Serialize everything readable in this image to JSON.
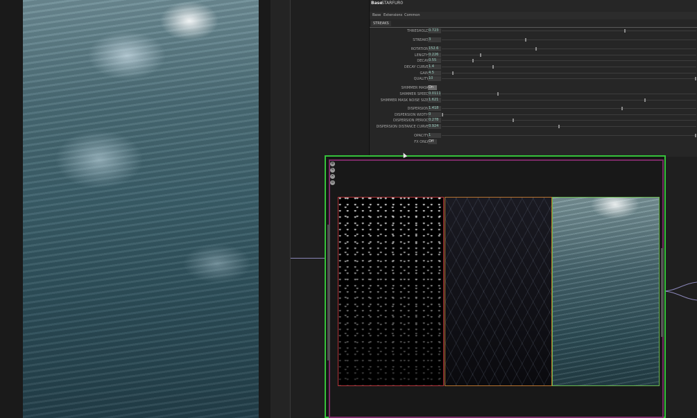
{
  "panel": {
    "op_type": "Base",
    "op_name": "STARFUR0",
    "tools": [
      "?",
      "⎙",
      "ℹ"
    ],
    "right_tools": [
      "✎",
      "▭",
      "↻",
      "●",
      "+",
      "◆"
    ],
    "tabs": [
      "Base",
      "Extensions",
      "Common"
    ],
    "active_subtab": "STREAKS",
    "params": [
      {
        "label": "THRESHOLD",
        "value": "0.723",
        "level": 0.72
      },
      {
        "label": "STREAKS",
        "value": "3",
        "level": 0.33
      },
      {
        "label": "ROTATION",
        "value": "152.6",
        "level": 0.37
      },
      {
        "label": "LENGTH",
        "value": "0.226",
        "level": 0.15
      },
      {
        "label": "DECAY",
        "value": "0.55",
        "level": 0.12
      },
      {
        "label": "DECAY CURVE",
        "value": "1.4",
        "level": 0.2
      },
      {
        "label": "GAIN",
        "value": "4.5",
        "level": 0.04
      },
      {
        "label": "QUALITY",
        "value": "10",
        "level": 1.0
      },
      {
        "label": "SHIMMER MASK",
        "value": "On",
        "level": 0
      },
      {
        "label": "SHIMMER SPEED",
        "value": "0.0111",
        "level": 0.22
      },
      {
        "label": "SHIMMER MASK NOISE SIZE",
        "value": "1.621",
        "level": 0.8
      },
      {
        "label": "DISPERSION",
        "value": "1.418",
        "level": 0.71
      },
      {
        "label": "DISPERSION WIDTH",
        "value": "0",
        "level": 0.0
      },
      {
        "label": "DISPERSION PERIOD",
        "value": "0.278",
        "level": 0.28
      },
      {
        "label": "DISPERSION DISTANCE CURVE",
        "value": "0.924",
        "level": 0.46
      },
      {
        "label": "OPACITY",
        "value": "1",
        "level": 1.0
      },
      {
        "label": "FX ONLY",
        "value": "Off",
        "level": 0
      }
    ]
  },
  "node": {
    "toolbar_icons": [
      "settings-icon",
      "pencil-icon",
      "close-icon",
      "pin-icon"
    ]
  },
  "colors": {
    "node_border": "#36c23b",
    "node_inner_border": "#7b2a66",
    "panel1_border": "#b5353a",
    "panel2_border": "#b8732f",
    "panel3_border": "#6ab84f",
    "param_value": "#9fd4c6"
  }
}
